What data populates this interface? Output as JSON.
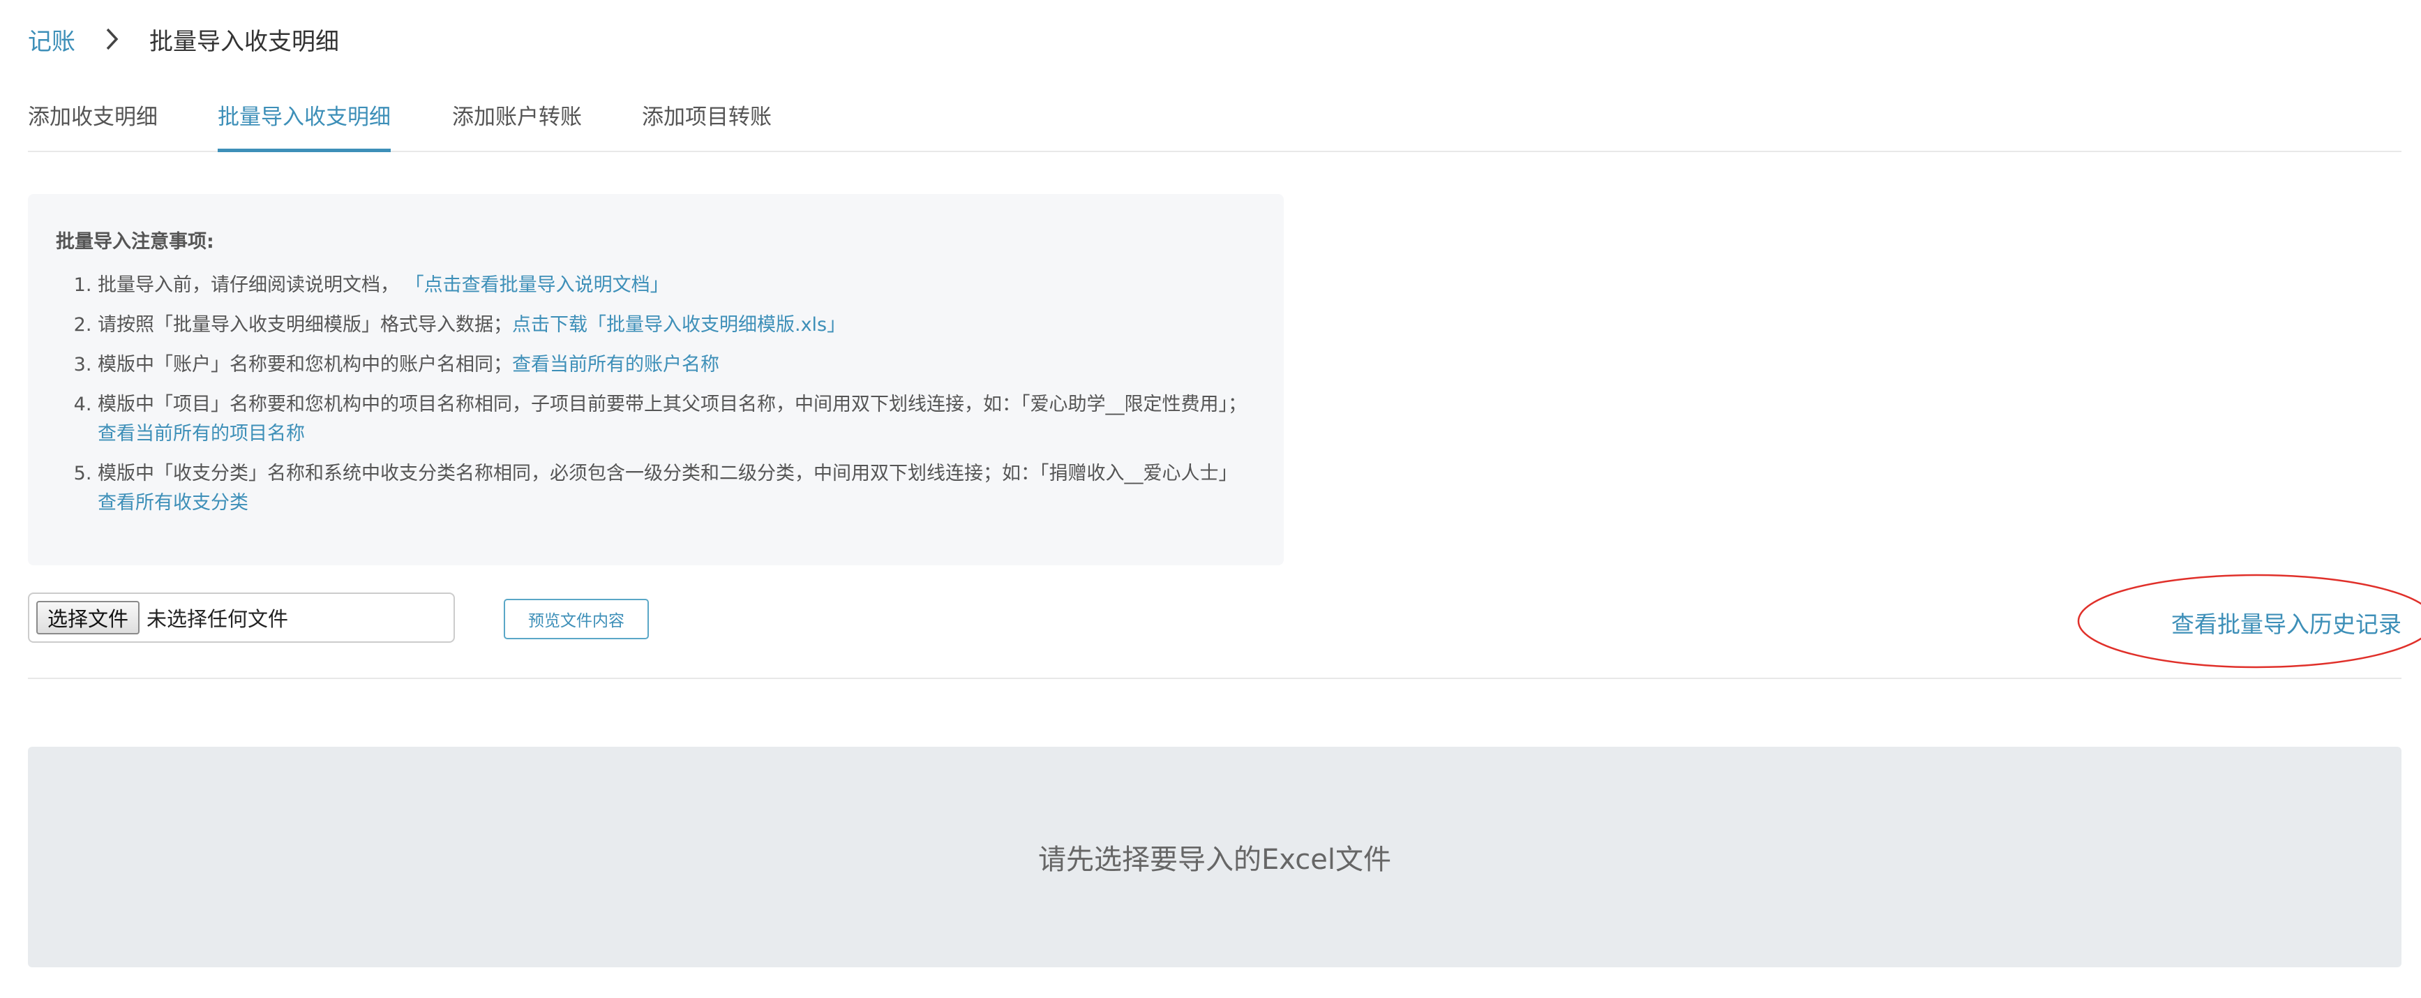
{
  "breadcrumb": {
    "root": "记账",
    "current": "批量导入收支明细"
  },
  "tabs": [
    {
      "label": "添加收支明细",
      "active": false
    },
    {
      "label": "批量导入收支明细",
      "active": true
    },
    {
      "label": "添加账户转账",
      "active": false
    },
    {
      "label": "添加项目转账",
      "active": false
    }
  ],
  "notice": {
    "title": "批量导入注意事项:",
    "items": [
      {
        "text": "批量导入前，请仔细阅读说明文档，",
        "link": "「点击查看批量导入说明文档」"
      },
      {
        "text": "请按照「批量导入收支明细模版」格式导入数据；",
        "link": "点击下载「批量导入收支明细模版.xls」"
      },
      {
        "text": "模版中「账户」名称要和您机构中的账户名相同；",
        "link": "查看当前所有的账户名称"
      },
      {
        "text": "模版中「项目」名称要和您机构中的项目名称相同，子项目前要带上其父项目名称，中间用双下划线连接，如：「爱心助学__限定性费用」；",
        "link": "查看当前所有的项目名称"
      },
      {
        "text": "模版中「收支分类」名称和系统中收支分类名称相同，必须包含一级分类和二级分类，中间用双下划线连接；如：「捐赠收入__爱心人士」",
        "link": "查看所有收支分类"
      }
    ]
  },
  "file_input": {
    "button_label": "选择文件",
    "status": "未选择任何文件"
  },
  "preview_button": "预览文件内容",
  "history_link": "查看批量导入历史记录",
  "placeholder_text": "请先选择要导入的Excel文件",
  "colors": {
    "accent": "#3d8fb8",
    "annotation": "#e0302a",
    "panel_bg": "#f6f7f9",
    "placeholder_bg": "#e8ebee"
  }
}
